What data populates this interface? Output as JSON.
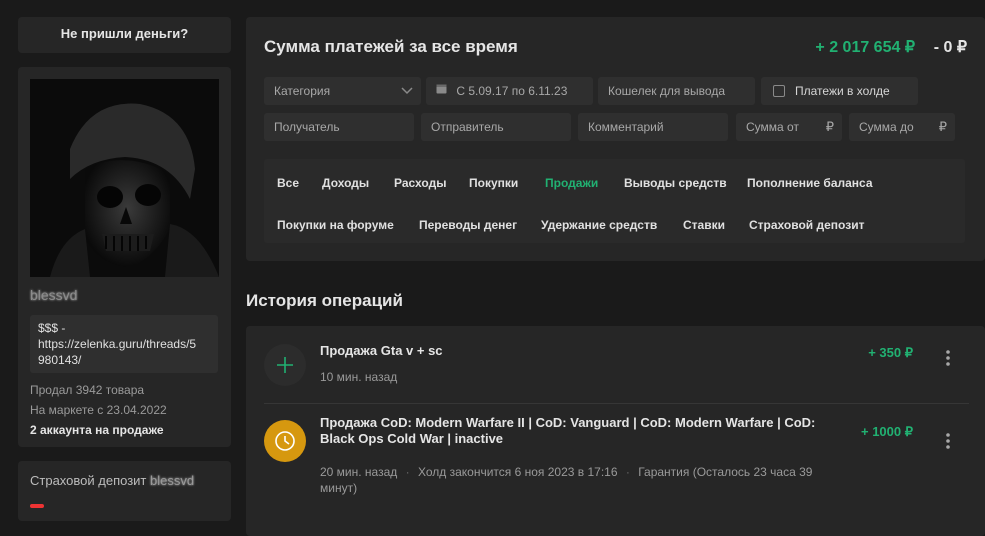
{
  "sidebar": {
    "not_paid_button": "Не пришли деньги?",
    "username": "blessvd",
    "thread_text": "$$$ - https://zelenka.guru/threads/5980143/",
    "thread_line1": "$$$ -",
    "thread_line2": "https://zelenka.guru/threads/5",
    "thread_line3": "980143/",
    "sold": "Продал 3942 товара",
    "since": "На маркете с 23.04.2022",
    "accounts_for_sale": "2 аккаунта на продаже",
    "insurance_label": "Страховой депозит",
    "insurance_user": "blessvd"
  },
  "summary": {
    "title": "Сумма платежей за все время",
    "plus": "+ 2 017 654 ₽",
    "minus": "- 0 ₽"
  },
  "filters": {
    "category": "Категория",
    "date_range": "С 5.09.17 по 6.11.23",
    "wallet": "Кошелек для вывода",
    "hold_label": "Платежи в холде",
    "recipient": "Получатель",
    "sender": "Отправитель",
    "comment": "Комментарий",
    "sum_from": "Сумма от",
    "sum_to": "Сумма до",
    "currency": "₽"
  },
  "tabs": {
    "all": "Все",
    "income": "Доходы",
    "expenses": "Расходы",
    "purchases": "Покупки",
    "sales": "Продажи",
    "withdrawals": "Выводы средств",
    "topup": "Пополнение баланса",
    "forum_purchases": "Покупки на форуме",
    "transfers": "Переводы денег",
    "holds": "Удержание средств",
    "bets": "Ставки",
    "insurance_deposit": "Страховой депозит",
    "active": "sales"
  },
  "history": {
    "title": "История операций",
    "operations": [
      {
        "title": "Продажа Gta v + sc",
        "time": "10 мин. назад",
        "amount": "+ 350 ₽",
        "icon": "plus-icon"
      },
      {
        "title_line1": "Продажа CoD: Modern Warfare II | CoD: Vanguard | CoD: Modern Warfare | CoD:",
        "title_line2": "Black Ops Cold War | inactive",
        "time": "20 мин. назад",
        "hold": "Холд закончится 6 ноя 2023 в 17:16",
        "guarantee_line1": "Гарантия (Осталось 23 часа 39",
        "guarantee_line2": "минут)",
        "amount": "+ 1000 ₽",
        "icon": "clock-icon"
      }
    ]
  },
  "colors": {
    "accent_green": "#21b172",
    "hold_orange": "#d6980f",
    "background": "#1a1a1a",
    "card": "#262626"
  }
}
